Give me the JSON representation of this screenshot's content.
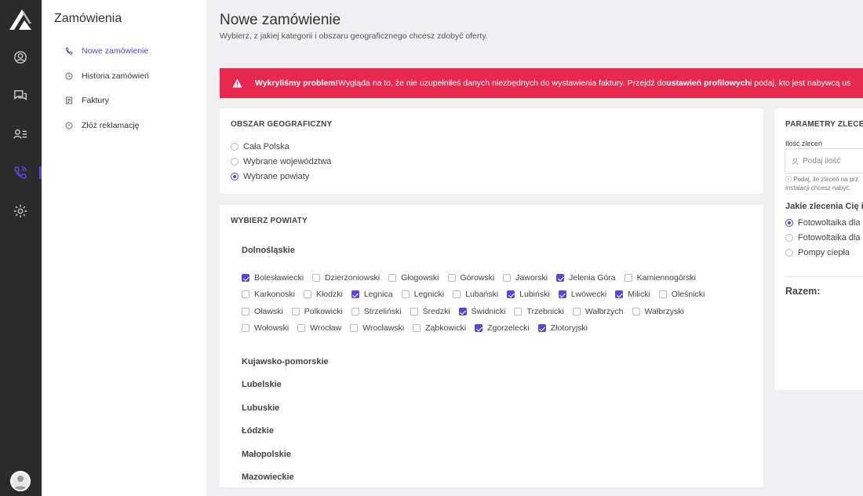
{
  "sidebar": {
    "title": "Zamówienia",
    "items": [
      {
        "label": "Nowe zamówienie"
      },
      {
        "label": "Historia zamówień"
      },
      {
        "label": "Faktury"
      },
      {
        "label": "Złóż reklamację"
      }
    ]
  },
  "page": {
    "title": "Nowe zamówienie",
    "subtitle": "Wybierz, z jakiej kategorii i obszaru geograficznego chcesz zdobyć oferty."
  },
  "alert": {
    "strong": "Wykryliśmy problem!",
    "text1": " Wygląda na to, że nie uzupełniłeś danych niezbędnych do wystawienia faktury. Przejdź do ",
    "link": "ustawień profilowych",
    "text2": " i podaj, kto jest nabywcą us"
  },
  "area": {
    "title": "OBSZAR GEOGRAFICZNY",
    "options": [
      "Cała Polska",
      "Wybrane województwa",
      "Wybrane powiaty"
    ],
    "selected_index": 2
  },
  "powiaty": {
    "title": "WYBIERZ POWIATY",
    "region": "Dolnośląskie",
    "rows": [
      [
        {
          "label": "Bolesławiecki",
          "checked": true
        },
        {
          "label": "Dzierżoniowski",
          "checked": false
        },
        {
          "label": "Głogowski",
          "checked": false
        },
        {
          "label": "Górowski",
          "checked": false
        },
        {
          "label": "Jaworski",
          "checked": false
        },
        {
          "label": "Jelenia Góra",
          "checked": true
        },
        {
          "label": "Kamiennogórski",
          "checked": false
        }
      ],
      [
        {
          "label": "Karkonoski",
          "checked": false
        },
        {
          "label": "Kłodzki",
          "checked": false
        },
        {
          "label": "Legnica",
          "checked": true
        },
        {
          "label": "Legnicki",
          "checked": false
        },
        {
          "label": "Lubański",
          "checked": false
        },
        {
          "label": "Lubiński",
          "checked": true
        },
        {
          "label": "Lwówecki",
          "checked": true
        },
        {
          "label": "Milicki",
          "checked": true
        },
        {
          "label": "Oleśnicki",
          "checked": false
        }
      ],
      [
        {
          "label": "Oławski",
          "checked": false
        },
        {
          "label": "Polkowicki",
          "checked": false
        },
        {
          "label": "Strzeliński",
          "checked": false
        },
        {
          "label": "Średzki",
          "checked": false
        },
        {
          "label": "Świdnicki",
          "checked": true
        },
        {
          "label": "Trzebnicki",
          "checked": false
        },
        {
          "label": "Wałbrzych",
          "checked": false
        },
        {
          "label": "Wałbrzyski",
          "checked": false
        }
      ],
      [
        {
          "label": "Wołowski",
          "checked": false
        },
        {
          "label": "Wrocław",
          "checked": false
        },
        {
          "label": "Wrocławski",
          "checked": false
        },
        {
          "label": "Ząbkowicki",
          "checked": false
        },
        {
          "label": "Zgorzelecki",
          "checked": true
        },
        {
          "label": "Złotoryjski",
          "checked": true
        }
      ]
    ],
    "other_regions": [
      "Kujawsko-pomorskie",
      "Lubelskie",
      "Lubuskie",
      "Łódzkie",
      "Małopolskie",
      "Mazowieckie"
    ]
  },
  "params": {
    "title": "PARAMETRY ZLECENI",
    "qty_label": "Ilość zleceń",
    "qty_placeholder": "Podaj ilość",
    "hint": "Podaj, ile zleceń na prz instalacji chcesz nabyć.",
    "question": "Jakie zlecenia Cię in",
    "options": [
      "Fotowoltaika dla",
      "Fotowoltaika dla",
      "Pompy ciepła"
    ],
    "selected_index": 0,
    "total_label": "Razem:"
  },
  "colors": {
    "accent": "#5b47d6",
    "alert": "#e8294f",
    "rail": "#2b2b2b"
  }
}
